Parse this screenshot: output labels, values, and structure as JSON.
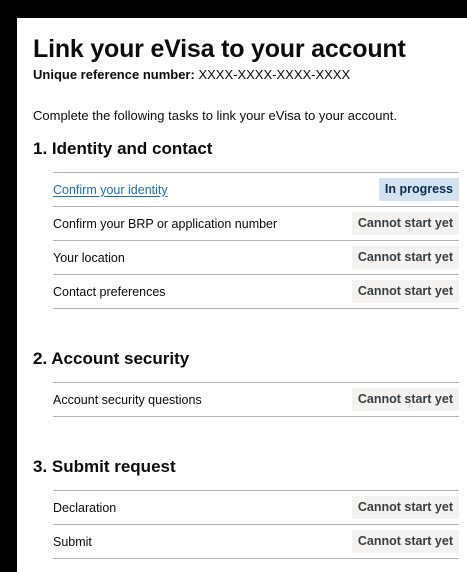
{
  "page": {
    "title": "Link your eVisa to your account",
    "reference_label": "Unique reference number:",
    "reference_value": "XXXX-XXXX-XXXX-XXXX",
    "intro": "Complete the following tasks to link your eVisa to your account."
  },
  "sections": [
    {
      "title": "1.  Identity and contact",
      "tasks": [
        {
          "name": "Confirm your identity",
          "status": "In progress",
          "link": true
        },
        {
          "name": "Confirm your BRP or application number",
          "status": "Cannot start yet",
          "link": false
        },
        {
          "name": "Your location",
          "status": "Cannot start yet",
          "link": false
        },
        {
          "name": "Contact preferences",
          "status": "Cannot start yet",
          "link": false
        }
      ]
    },
    {
      "title": "2.  Account security",
      "tasks": [
        {
          "name": "Account security questions",
          "status": "Cannot start yet",
          "link": false
        }
      ]
    },
    {
      "title": "3.  Submit request",
      "tasks": [
        {
          "name": "Declaration",
          "status": "Cannot start yet",
          "link": false
        },
        {
          "name": "Submit",
          "status": "Cannot start yet",
          "link": false
        }
      ]
    }
  ],
  "colors": {
    "link": "#1d70b8",
    "tag_in_progress_bg": "#d2e2f1",
    "tag_cannot_start_bg": "#f3f2f1",
    "border": "#b1b4b6"
  }
}
